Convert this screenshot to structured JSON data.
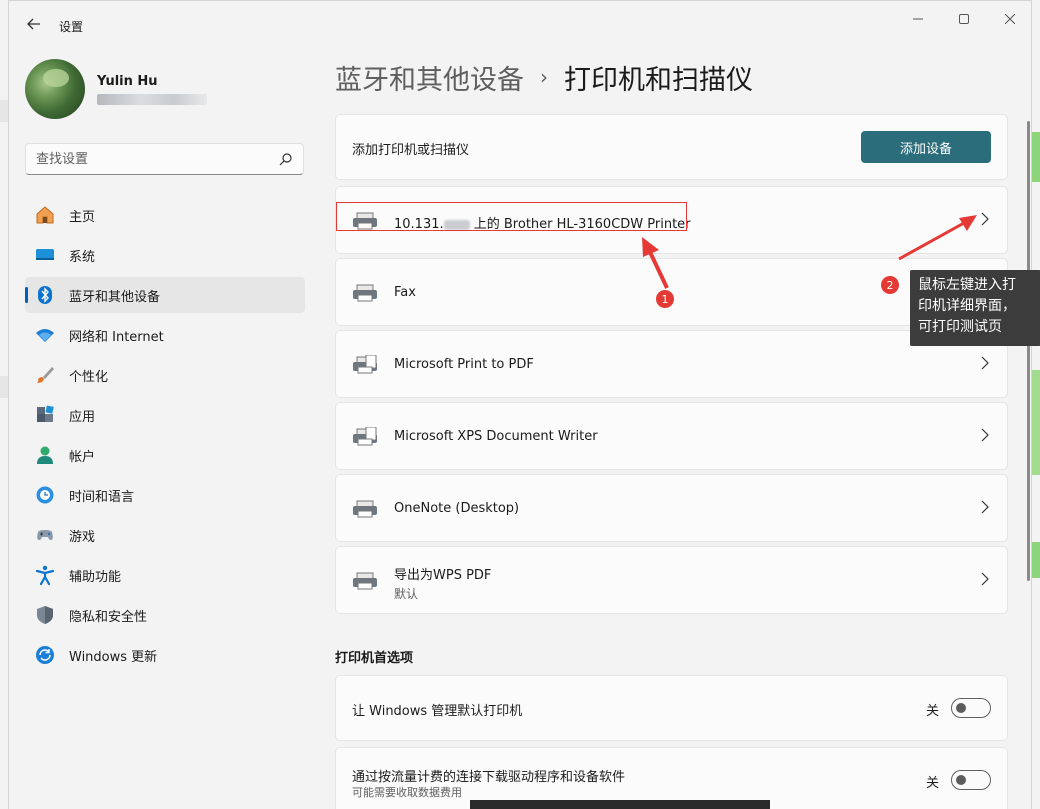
{
  "window": {
    "title": "设置",
    "controls": [
      "minimize",
      "maximize",
      "close"
    ]
  },
  "user": {
    "name": "Yulin Hu"
  },
  "search": {
    "placeholder": "查找设置",
    "value": ""
  },
  "nav": {
    "items": [
      {
        "label": "主页",
        "icon": "home-icon"
      },
      {
        "label": "系统",
        "icon": "monitor-icon"
      },
      {
        "label": "蓝牙和其他设备",
        "icon": "bluetooth-icon",
        "active": true
      },
      {
        "label": "网络和 Internet",
        "icon": "wifi-icon"
      },
      {
        "label": "个性化",
        "icon": "brush-icon"
      },
      {
        "label": "应用",
        "icon": "apps-icon"
      },
      {
        "label": "帐户",
        "icon": "person-icon"
      },
      {
        "label": "时间和语言",
        "icon": "globe-clock-icon"
      },
      {
        "label": "游戏",
        "icon": "gamepad-icon"
      },
      {
        "label": "辅助功能",
        "icon": "accessibility-icon"
      },
      {
        "label": "隐私和安全性",
        "icon": "shield-icon"
      },
      {
        "label": "Windows 更新",
        "icon": "update-icon"
      }
    ]
  },
  "breadcrumb": {
    "parent": "蓝牙和其他设备",
    "separator": "›",
    "current": "打印机和扫描仪"
  },
  "add_printer": {
    "label": "添加打印机或扫描仪",
    "button": "添加设备"
  },
  "printers": [
    {
      "name_prefix": "10.131.",
      "name_suffix": " 上的 Brother HL-3160CDW Printer",
      "sub": ""
    },
    {
      "name": "Fax",
      "sub": ""
    },
    {
      "name": "Microsoft Print to PDF",
      "sub": ""
    },
    {
      "name": "Microsoft XPS Document Writer",
      "sub": ""
    },
    {
      "name": "OneNote (Desktop)",
      "sub": ""
    },
    {
      "name": "导出为WPS PDF",
      "sub": "默认"
    }
  ],
  "preferences": {
    "title": "打印机首选项",
    "rows": [
      {
        "label": "让 Windows 管理默认打印机",
        "sub": "",
        "state": "关"
      },
      {
        "label": "通过按流量计费的连接下载驱动程序和设备软件",
        "sub": "可能需要收取数据费用",
        "state": "关"
      }
    ]
  },
  "annotations": {
    "badge1": "1",
    "badge2": "2",
    "tooltip_lines": [
      "鼠标左键进入打",
      "印机详细界面，",
      "可打印测试页"
    ],
    "color": "#e53935"
  },
  "colors": {
    "accent": "#005fb8",
    "button": "#2b6d7a"
  }
}
